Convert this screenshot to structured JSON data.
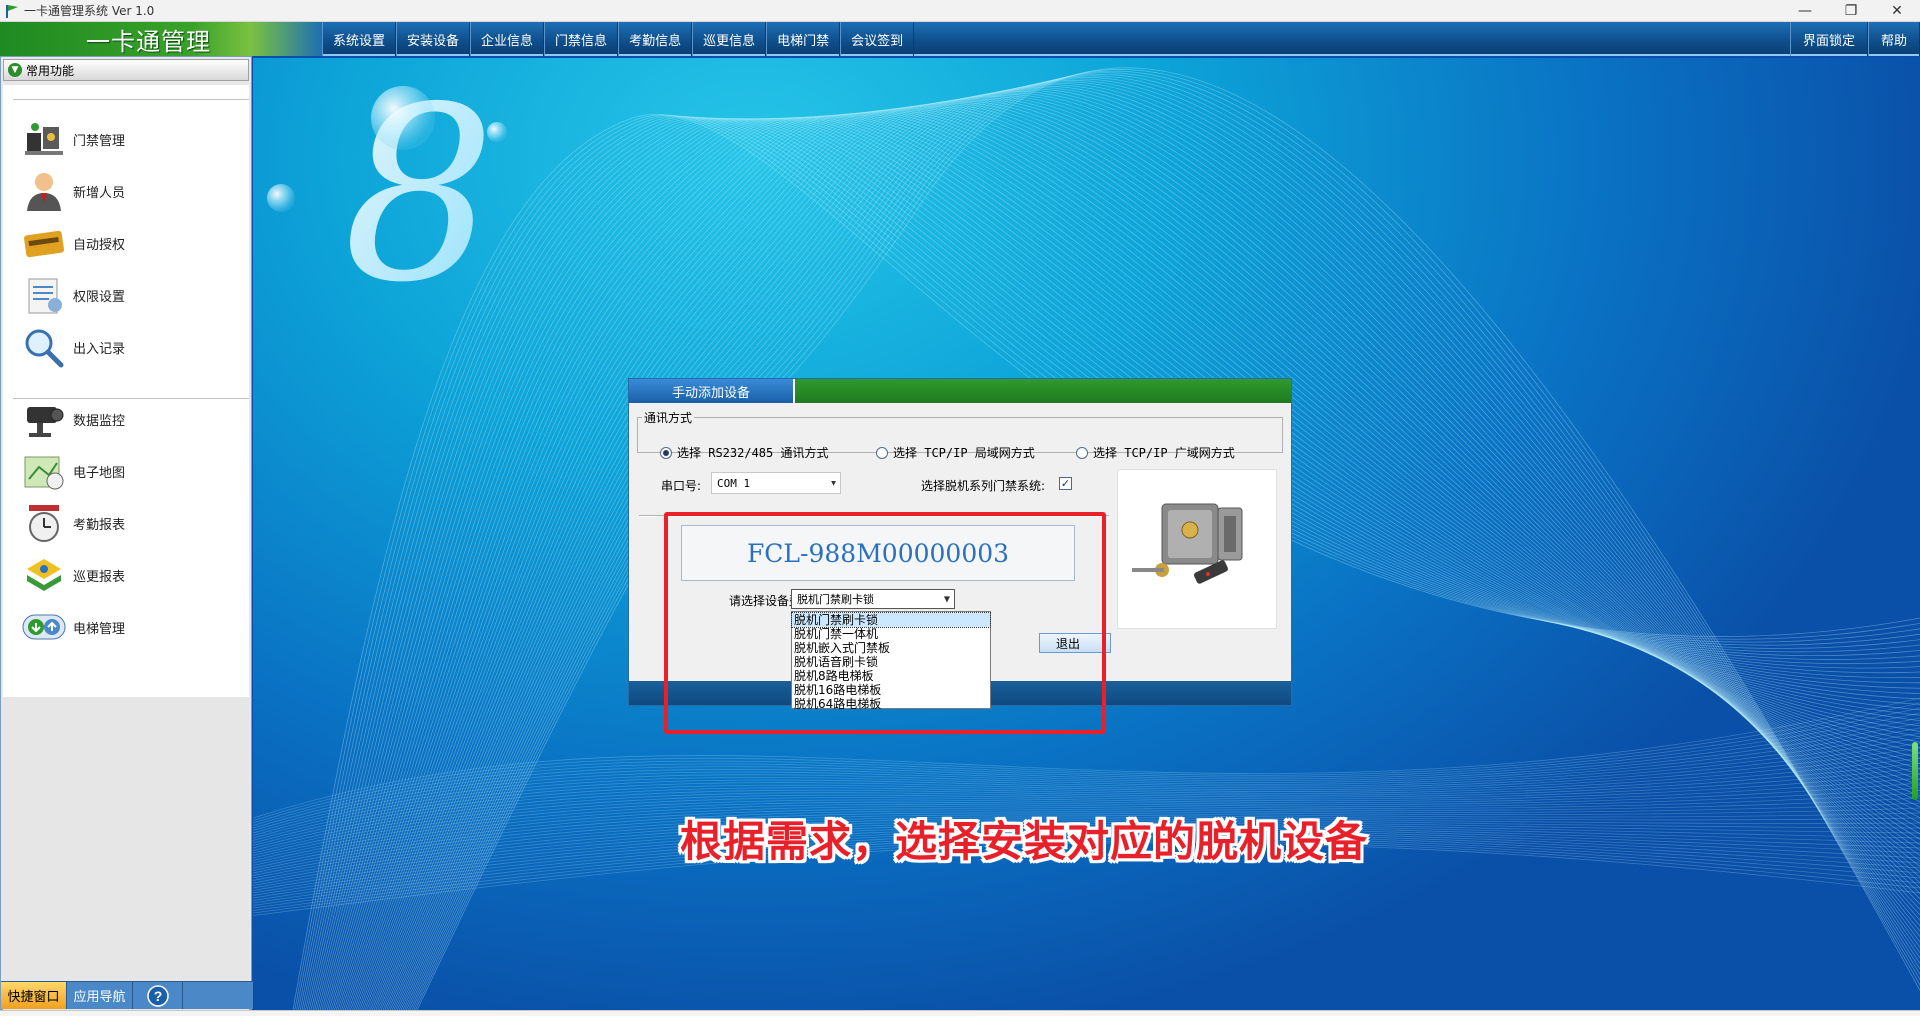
{
  "window": {
    "title": "一卡通管理系统 Ver 1.0",
    "min_icon": "minimize-icon",
    "max_icon": "restore-icon",
    "close_icon": "close-icon"
  },
  "brand": "一卡通管理",
  "menus": [
    "系统设置",
    "安装设备",
    "企业信息",
    "门禁信息",
    "考勤信息",
    "巡更信息",
    "电梯门禁",
    "会议签到"
  ],
  "right_menus": [
    "界面锁定",
    "帮助"
  ],
  "left_panel": {
    "header": "常用功能",
    "items": [
      {
        "label": "门禁管理",
        "icon": "access-control-icon"
      },
      {
        "label": "新增人员",
        "icon": "person-icon"
      },
      {
        "label": "自动授权",
        "icon": "card-icon"
      },
      {
        "label": "权限设置",
        "icon": "permission-icon"
      },
      {
        "label": "出入记录",
        "icon": "magnifier-icon"
      },
      {
        "label": "数据监控",
        "icon": "camera-icon"
      },
      {
        "label": "电子地图",
        "icon": "map-icon"
      },
      {
        "label": "考勤报表",
        "icon": "clock-icon"
      },
      {
        "label": "巡更报表",
        "icon": "patrol-icon"
      },
      {
        "label": "电梯管理",
        "icon": "elevator-icon"
      }
    ],
    "tabs": [
      "快捷窗口",
      "应用导航"
    ],
    "help_icon": "help-icon"
  },
  "dialog": {
    "tab": "手动添加设备",
    "comm_legend": "通讯方式",
    "radios": [
      {
        "label": "选择 RS232/485 通讯方式",
        "checked": true
      },
      {
        "label": "选择 TCP/IP 局域网方式",
        "checked": false
      },
      {
        "label": "选择 TCP/IP 广域网方式",
        "checked": false
      }
    ],
    "serial_label": "串口号:",
    "serial_value": "COM 1",
    "offline_label": "选择脱机系列门禁系统:",
    "offline_checked": true,
    "model_display": "FCL-988M00000003",
    "model_label": "请选择设备型号:",
    "model_value": "脱机门禁刷卡锁",
    "exit_label": "退出",
    "device_image_icon": "door-lock-image",
    "options": [
      "脱机门禁刷卡锁",
      "脱机门禁一体机",
      "脱机嵌入式门禁板",
      "脱机语音刷卡锁",
      "脱机8路电梯板",
      "脱机16路电梯板",
      "脱机64路电梯板"
    ],
    "selected_option": 0
  },
  "annotation": "根据需求，选择安装对应的脱机设备",
  "colors": {
    "accent_red": "#e8202a",
    "menu_blue": "#0f4f8c",
    "brand_green": "#2f9a2f"
  }
}
